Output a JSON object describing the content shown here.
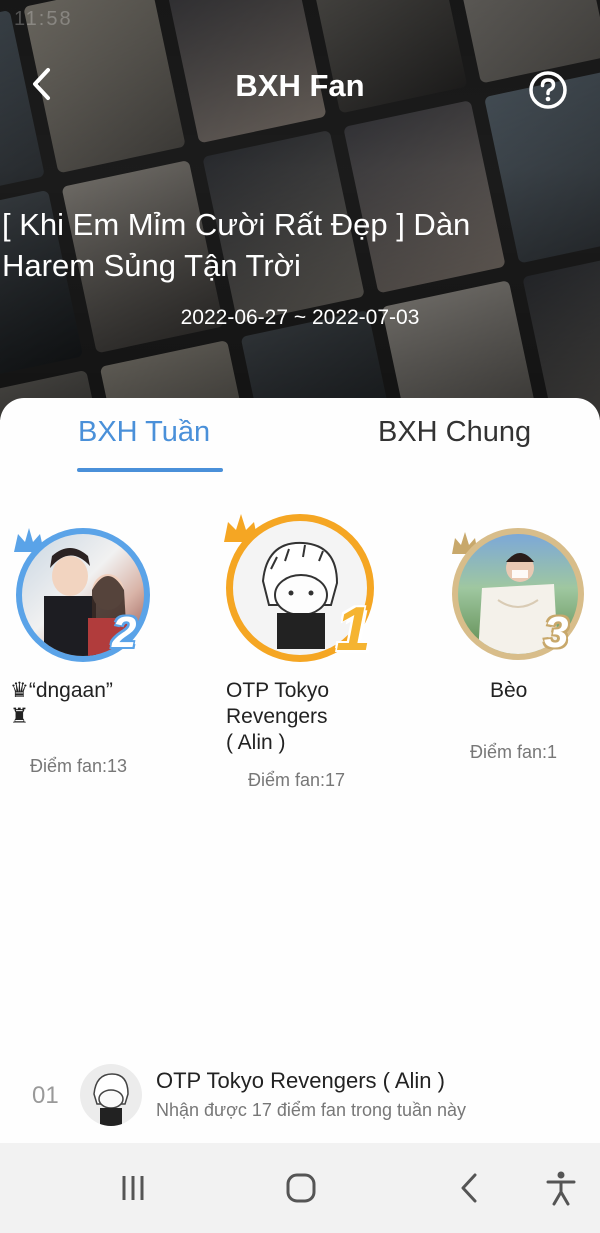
{
  "status_bar": {
    "time": "11:58"
  },
  "header": {
    "title": "BXH Fan",
    "back_icon": "chevron-left-icon",
    "help_icon": "question-circle-icon"
  },
  "story": {
    "title": "[ Khi Em Mỉm Cười Rất Đẹp ] Dàn Harem Sủng Tận Trời",
    "date_range": "2022-06-27 ~ 2022-07-03"
  },
  "tabs": [
    {
      "label": "BXH Tuần",
      "active": true
    },
    {
      "label": "BXH Chung",
      "active": false
    }
  ],
  "podium": [
    {
      "rank": "2",
      "name_line1": "♛“dngaan”",
      "name_line2": "♜",
      "score": "Điểm fan:13",
      "ring_color": "#5aa3e8",
      "crown_color": "#5aa3e8"
    },
    {
      "rank": "1",
      "name_line1": "OTP Tokyo",
      "name_line2": "Revengers",
      "name_line3": "( Alin )",
      "score": "Điểm fan:17",
      "ring_color": "#f5a623",
      "crown_color": "#f5a623"
    },
    {
      "rank": "3",
      "name_line1": "Bèo ",
      "score": "Điểm fan:1",
      "ring_color": "#c8a86b",
      "crown_color": "#c8a86b"
    }
  ],
  "ranking_list": [
    {
      "rank": "01",
      "name": "OTP Tokyo Revengers ( Alin )",
      "subtitle": "Nhận được 17 điểm fan trong tuần này"
    }
  ],
  "navbar": {
    "recent_icon": "recent-apps-icon",
    "home_icon": "home-icon",
    "back_icon": "back-icon",
    "accessibility_icon": "accessibility-icon"
  }
}
